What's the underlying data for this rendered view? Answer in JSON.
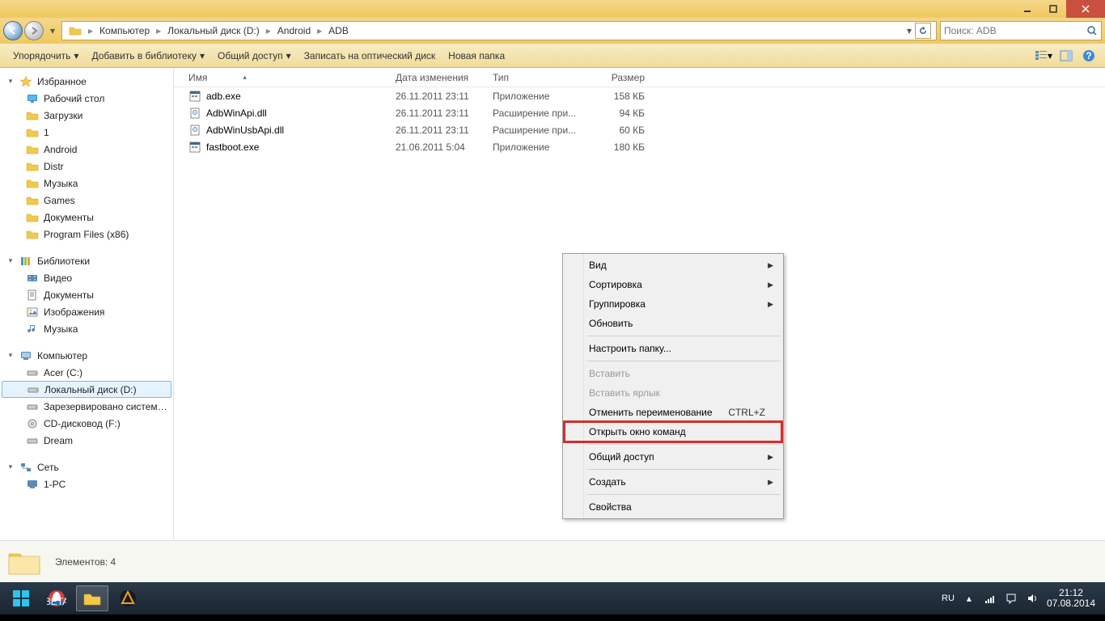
{
  "breadcrumb": {
    "seg1": "Компьютер",
    "seg2": "Локальный диск (D:)",
    "seg3": "Android",
    "seg4": "ADB"
  },
  "search": {
    "placeholder": "Поиск: ADB"
  },
  "toolbar": {
    "organize": "Упорядочить",
    "addlib": "Добавить в библиотеку",
    "share": "Общий доступ",
    "burn": "Записать на оптический диск",
    "newfolder": "Новая папка"
  },
  "columns": {
    "name": "Имя",
    "date": "Дата изменения",
    "type": "Тип",
    "size": "Размер"
  },
  "files": [
    {
      "name": "adb.exe",
      "date": "26.11.2011 23:11",
      "type": "Приложение",
      "size": "158 КБ",
      "kind": "exe"
    },
    {
      "name": "AdbWinApi.dll",
      "date": "26.11.2011 23:11",
      "type": "Расширение при...",
      "size": "94 КБ",
      "kind": "dll"
    },
    {
      "name": "AdbWinUsbApi.dll",
      "date": "26.11.2011 23:11",
      "type": "Расширение при...",
      "size": "60 КБ",
      "kind": "dll"
    },
    {
      "name": "fastboot.exe",
      "date": "21.06.2011 5:04",
      "type": "Приложение",
      "size": "180 КБ",
      "kind": "exe"
    }
  ],
  "sidebar": {
    "fav": {
      "label": "Избранное",
      "items": [
        "Рабочий стол",
        "Загрузки",
        "1",
        "Android",
        "Distr",
        "Музыка",
        "Games",
        "Документы",
        "Program Files (x86)"
      ]
    },
    "lib": {
      "label": "Библиотеки",
      "items": [
        "Видео",
        "Документы",
        "Изображения",
        "Музыка"
      ]
    },
    "comp": {
      "label": "Компьютер",
      "items": [
        "Acer (C:)",
        "Локальный диск (D:)",
        "Зарезервировано системой (",
        "CD-дисковод (F:)",
        "Dream"
      ]
    },
    "net": {
      "label": "Сеть",
      "items": [
        "1-PC"
      ]
    }
  },
  "contextmenu": {
    "view": "Вид",
    "sort": "Сортировка",
    "group": "Группировка",
    "refresh": "Обновить",
    "customize": "Настроить папку...",
    "paste": "Вставить",
    "pastelink": "Вставить ярлык",
    "undo": "Отменить переименование",
    "undo_shortcut": "CTRL+Z",
    "opencmd": "Открыть окно команд",
    "share": "Общий доступ",
    "create": "Создать",
    "properties": "Свойства"
  },
  "status": {
    "text": "Элементов: 4"
  },
  "tray": {
    "lang": "RU",
    "time": "21:12",
    "date": "07.08.2014"
  }
}
